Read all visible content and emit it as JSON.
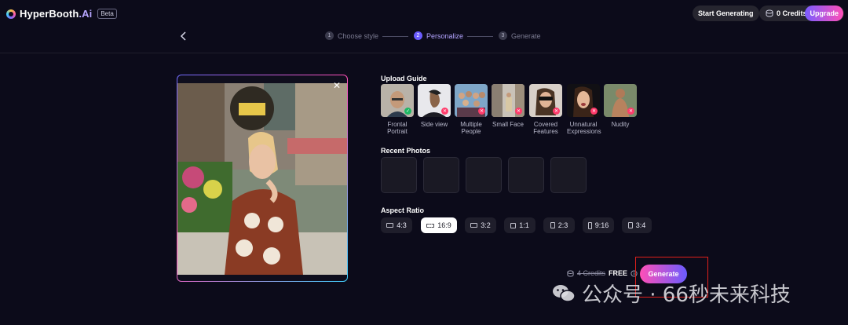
{
  "app": {
    "name": "HyperBooth",
    "name_suffix": ".Ai",
    "badge": "Beta"
  },
  "header": {
    "start_label": "Start Generating",
    "credits_label": "0 Credits",
    "upgrade_label": "Upgrade"
  },
  "stepper": {
    "steps": [
      {
        "num": "1",
        "label": "Choose style"
      },
      {
        "num": "2",
        "label": "Personalize"
      },
      {
        "num": "3",
        "label": "Generate"
      }
    ]
  },
  "upload_guide": {
    "title": "Upload Guide",
    "items": [
      {
        "label": "Frontal Portrait",
        "status": "ok"
      },
      {
        "label": "Side view",
        "status": "no"
      },
      {
        "label": "Multiple People",
        "status": "no"
      },
      {
        "label": "Small Face",
        "status": "no"
      },
      {
        "label": "Covered Features",
        "status": "no"
      },
      {
        "label": "Unnatural Expressions",
        "status": "no"
      },
      {
        "label": "Nudity",
        "status": "no"
      }
    ]
  },
  "recent": {
    "title": "Recent Photos"
  },
  "aspect": {
    "title": "Aspect Ratio",
    "options": [
      "4:3",
      "16:9",
      "3:2",
      "1:1",
      "2:3",
      "9:16",
      "3:4"
    ],
    "selected": "16:9"
  },
  "generate": {
    "cost_strike": "4 Credits",
    "cost_free": "FREE",
    "button_label": "Generate"
  },
  "watermark": {
    "text": "公众号 · 66秒未来科技"
  },
  "colors": {
    "background": "#0c0b1a",
    "accent": "#6b5cff",
    "accent_pink": "#ff4fb7",
    "ok": "#1eb864",
    "bad": "#ff3b6b",
    "highlight_box": "#e0201b"
  }
}
